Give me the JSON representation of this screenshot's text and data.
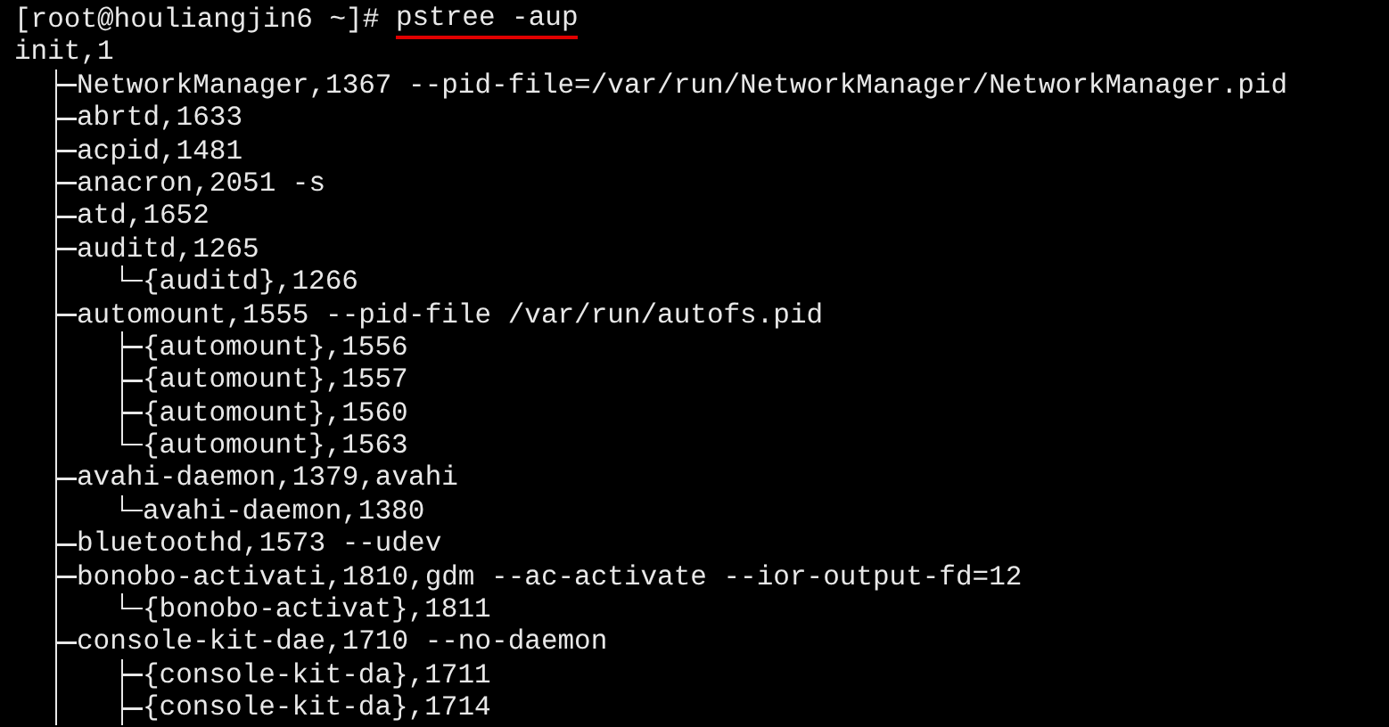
{
  "terminal": {
    "prompt": "[root@houliangjin6 ~]#",
    "command": {
      "text": "pstree -aup",
      "underlined": true
    },
    "tree": {
      "label": "init,1",
      "children": [
        {
          "label": "NetworkManager,1367 --pid-file=/var/run/NetworkManager/NetworkManager.pid",
          "last": false
        },
        {
          "label": "abrtd,1633",
          "last": false
        },
        {
          "label": "acpid,1481",
          "last": false
        },
        {
          "label": "anacron,2051 -s",
          "last": false
        },
        {
          "label": "atd,1652",
          "last": false
        },
        {
          "label": "auditd,1265",
          "last": false,
          "children": [
            {
              "label": "{auditd},1266",
              "last": true
            }
          ]
        },
        {
          "label": "automount,1555 --pid-file /var/run/autofs.pid",
          "last": false,
          "children": [
            {
              "label": "{automount},1556",
              "last": false
            },
            {
              "label": "{automount},1557",
              "last": false
            },
            {
              "label": "{automount},1560",
              "last": false
            },
            {
              "label": "{automount},1563",
              "last": true
            }
          ]
        },
        {
          "label": "avahi-daemon,1379,avahi",
          "last": false,
          "children": [
            {
              "label": "avahi-daemon,1380",
              "last": true
            }
          ]
        },
        {
          "label": "bluetoothd,1573 --udev",
          "last": false
        },
        {
          "label": "bonobo-activati,1810,gdm --ac-activate --ior-output-fd=12",
          "last": false,
          "children": [
            {
              "label": "{bonobo-activat},1811",
              "last": true
            }
          ]
        },
        {
          "label": "console-kit-dae,1710 --no-daemon",
          "last": false,
          "children": [
            {
              "label": "{console-kit-da},1711",
              "last": false
            },
            {
              "label": "{console-kit-da},1714",
              "last": false
            }
          ]
        }
      ]
    }
  }
}
